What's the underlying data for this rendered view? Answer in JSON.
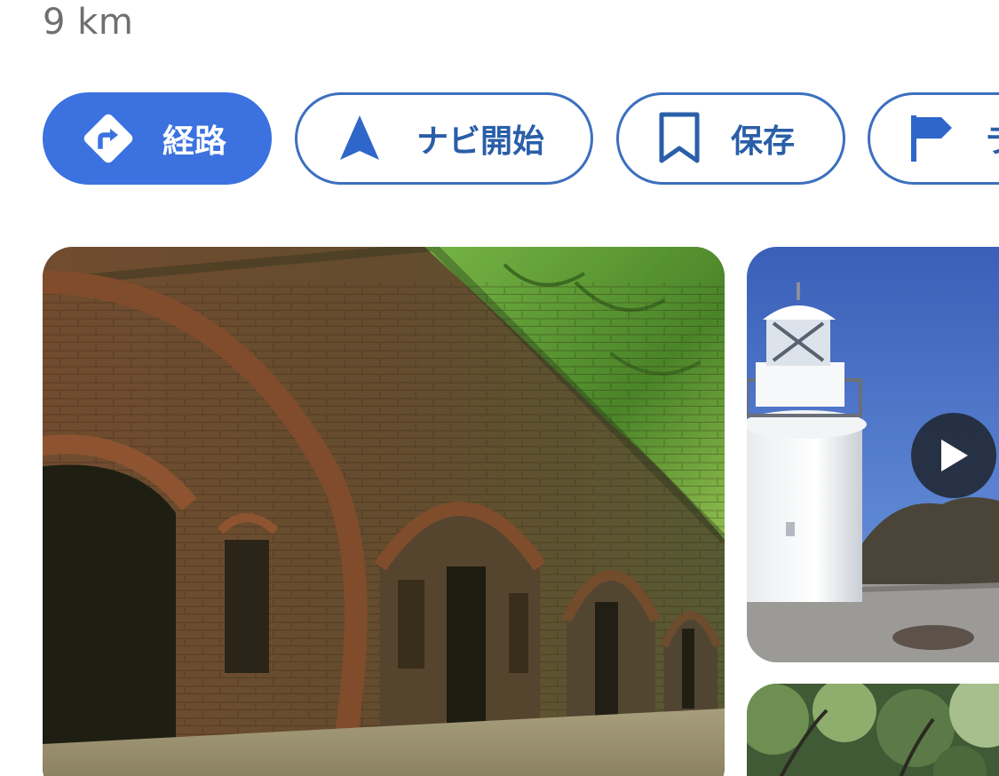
{
  "header": {
    "distance": "9 km"
  },
  "actions": [
    {
      "label": "経路",
      "icon": "directions-icon",
      "style": "primary"
    },
    {
      "label": "ナビ開始",
      "icon": "navigation-arrow-icon",
      "style": "outline"
    },
    {
      "label": "保存",
      "icon": "bookmark-icon",
      "style": "outline"
    },
    {
      "label": "ラ",
      "icon": "flag-icon",
      "style": "outline"
    }
  ],
  "photos": {
    "main": {
      "subject": "brick-arch-fortress-photo"
    },
    "side_top": {
      "subject": "lighthouse-video-thumbnail",
      "has_video": true
    },
    "side_bottom": {
      "subject": "forest-photo"
    }
  },
  "colors": {
    "primary": "#3b72e0",
    "outline": "#3c6fbf",
    "distance_text": "#6f6f6f"
  }
}
